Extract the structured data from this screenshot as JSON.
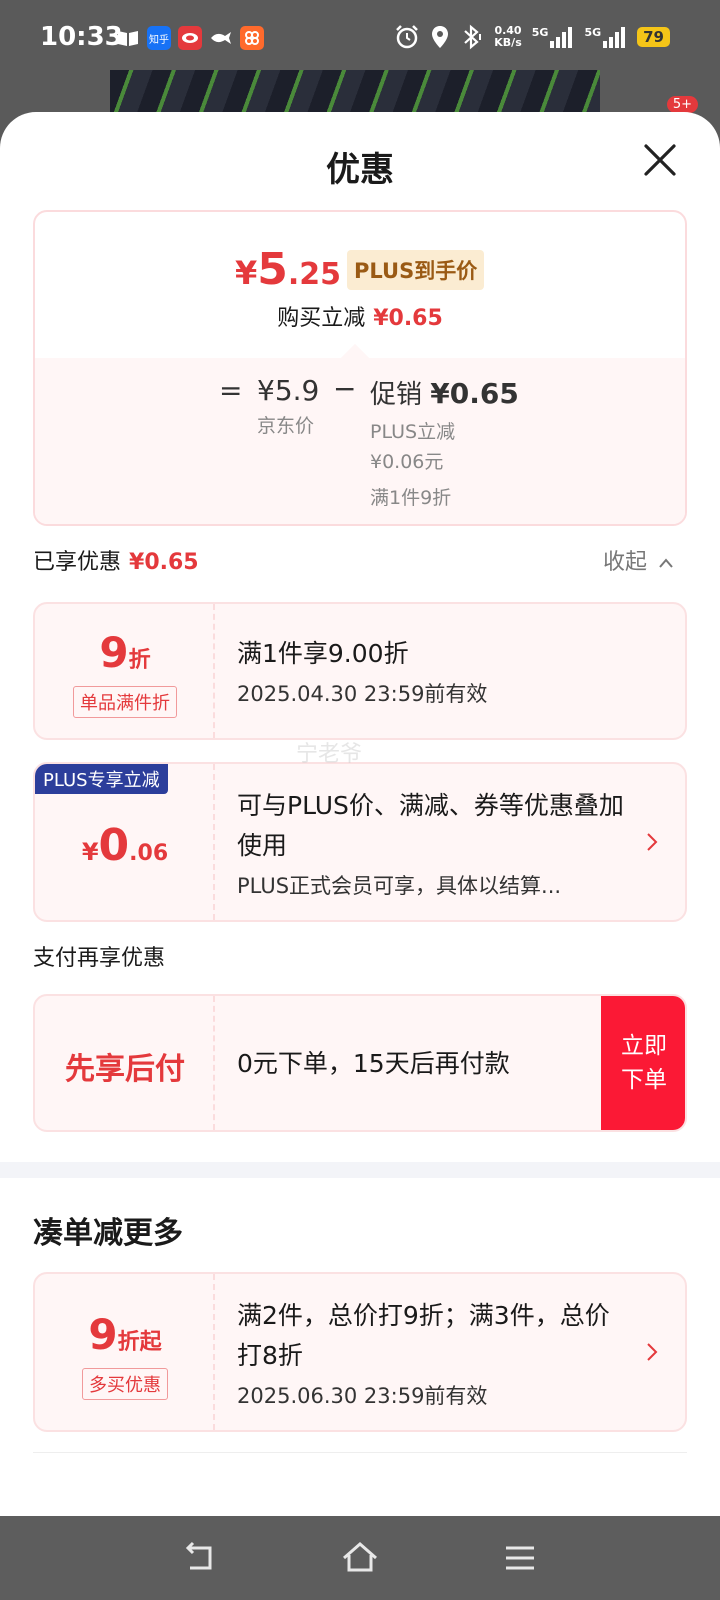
{
  "status": {
    "time": "10:33",
    "app_icons": [
      {
        "name": "book-icon",
        "label": "",
        "color": "#5a5a5a"
      },
      {
        "name": "zhihu-icon",
        "label": "知乎",
        "color": "#1772f6"
      },
      {
        "name": "app-red-icon",
        "label": "",
        "color": "#e4393c"
      },
      {
        "name": "fish-icon",
        "label": "",
        "color": "#5a5a5a"
      },
      {
        "name": "app-orange-icon",
        "label": "",
        "color": "#ff6a2c"
      }
    ],
    "net_speed": "0.40",
    "net_unit": "KB/s",
    "sig1": "5G",
    "sig2": "5G",
    "battery": "79",
    "badge": "5+"
  },
  "sheet": {
    "title": "优惠",
    "final_price": {
      "yen": "¥",
      "int": "5",
      "dec": ".25"
    },
    "plus_tag": "PLUS到手价",
    "reduce_label": "购买立减",
    "reduce_amount": "¥0.65",
    "eq": "=",
    "jd_price": "¥5.9",
    "jd_label": "京东价",
    "minus": "−",
    "promo_label": "促销",
    "promo_amount": "¥0.65",
    "promo_sub1": "PLUS立减",
    "promo_sub2": "¥0.06元",
    "promo_sub3": "满1件9折",
    "enjoyed_label": "已享优惠",
    "enjoyed_amount": "¥0.65",
    "collapse": "收起",
    "coupons": [
      {
        "num": "9",
        "unit": "折",
        "tag": "单品满件折",
        "line1": "满1件享9.00折",
        "line2": "2025.04.30 23:59前有效"
      },
      {
        "ribbon": "PLUS专享立减",
        "yen": "¥",
        "int": "0",
        "dec": ".06",
        "line1": "可与PLUS价、满减、券等优惠叠加使用",
        "line2": "PLUS正式会员可享，具体以结算..."
      }
    ],
    "pay_label": "支付再享优惠",
    "pay": {
      "title": "先享后付",
      "desc": "0元下单，15天后再付款",
      "btn1": "立即",
      "btn2": "下单"
    },
    "more_title": "凑单减更多",
    "more": {
      "num": "9",
      "unit": "折起",
      "tag": "多买优惠",
      "line1": "满2件，总价打9折；满3件，总价打8折",
      "line2": "2025.06.30 23:59前有效"
    },
    "watermark": "宁老爷"
  }
}
